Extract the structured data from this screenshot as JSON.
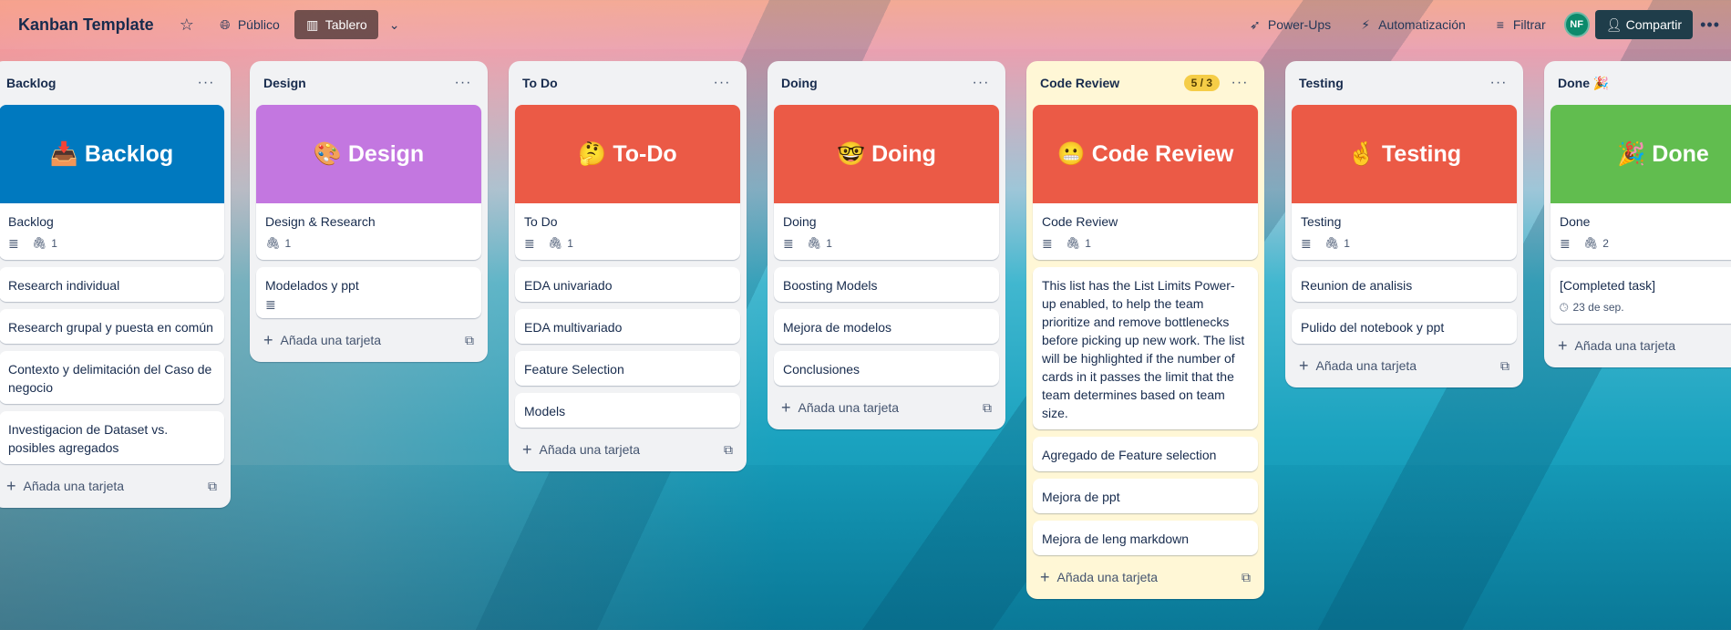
{
  "header": {
    "board_title": "Kanban Template",
    "visibility": "Público",
    "view_label": "Tablero",
    "powerups": "Power-Ups",
    "automation": "Automatización",
    "filter": "Filtrar",
    "avatar_initials": "NF",
    "share": "Compartir"
  },
  "colors": {
    "backlog_cover": "#0079bf",
    "design_cover": "#c377e0",
    "todo_cover": "#eb5a46",
    "doing_cover": "#eb5a46",
    "codereview_cover": "#eb5a46",
    "testing_cover": "#eb5a46",
    "done_cover": "#61bd4f",
    "limit_badge": "#f5cd47"
  },
  "add_card_label": "Añada una tarjeta",
  "lists": {
    "backlog": {
      "title": "Backlog",
      "cover_text": "📥 Backlog",
      "header_card": {
        "title": "Backlog",
        "attachments": "1"
      },
      "cards": [
        "Research individual",
        "Research grupal y puesta en común",
        "Contexto y delimitación del Caso de negocio",
        "Investigacion de Dataset vs. posibles agregados"
      ]
    },
    "design": {
      "title": "Design",
      "cover_text": "🎨 Design",
      "header_card": {
        "title": "Design & Research",
        "attachments": "1"
      },
      "cards": [
        "Modelados y ppt"
      ]
    },
    "todo": {
      "title": "To Do",
      "cover_text": "🤔 To-Do",
      "header_card": {
        "title": "To Do",
        "attachments": "1"
      },
      "cards": [
        "EDA univariado",
        "EDA multivariado",
        "Feature Selection",
        "Models"
      ]
    },
    "doing": {
      "title": "Doing",
      "cover_text": "🤓 Doing",
      "header_card": {
        "title": "Doing",
        "attachments": "1"
      },
      "cards": [
        "Boosting Models",
        "Mejora de modelos",
        "Conclusiones"
      ]
    },
    "codereview": {
      "title": "Code Review",
      "limit": "5 / 3",
      "cover_text": "😬 Code Review",
      "header_card": {
        "title": "Code Review",
        "attachments": "1"
      },
      "info": "This list has the List Limits Power-up enabled, to help the team prioritize and remove bottlenecks before picking up new work. The list will be highlighted if the number of cards in it passes the limit that the team determines based on team size.",
      "cards": [
        "Agregado de Feature selection",
        "Mejora de ppt",
        "Mejora de leng markdown"
      ]
    },
    "testing": {
      "title": "Testing",
      "cover_text": "🤞 Testing",
      "header_card": {
        "title": "Testing",
        "attachments": "1"
      },
      "cards": [
        "Reunion de analisis",
        "Pulido del notebook y ppt"
      ]
    },
    "done": {
      "title": "Done 🎉",
      "cover_text": "🎉 Done",
      "header_card": {
        "title": "Done",
        "attachments": "2"
      },
      "completed": {
        "title": "[Completed task]",
        "date": "23 de sep."
      }
    }
  },
  "icons": {
    "star": "star-icon",
    "globe": "globe-icon",
    "board": "board-icon",
    "chevron": "chevron-down-icon",
    "rocket": "rocket-icon",
    "bolt": "bolt-icon",
    "filter": "filter-icon",
    "person_add": "person-add-icon",
    "more": "more-icon",
    "description": "description-icon",
    "attachment": "paperclip-icon",
    "plus": "plus-icon",
    "template": "template-icon",
    "clock": "clock-icon"
  }
}
